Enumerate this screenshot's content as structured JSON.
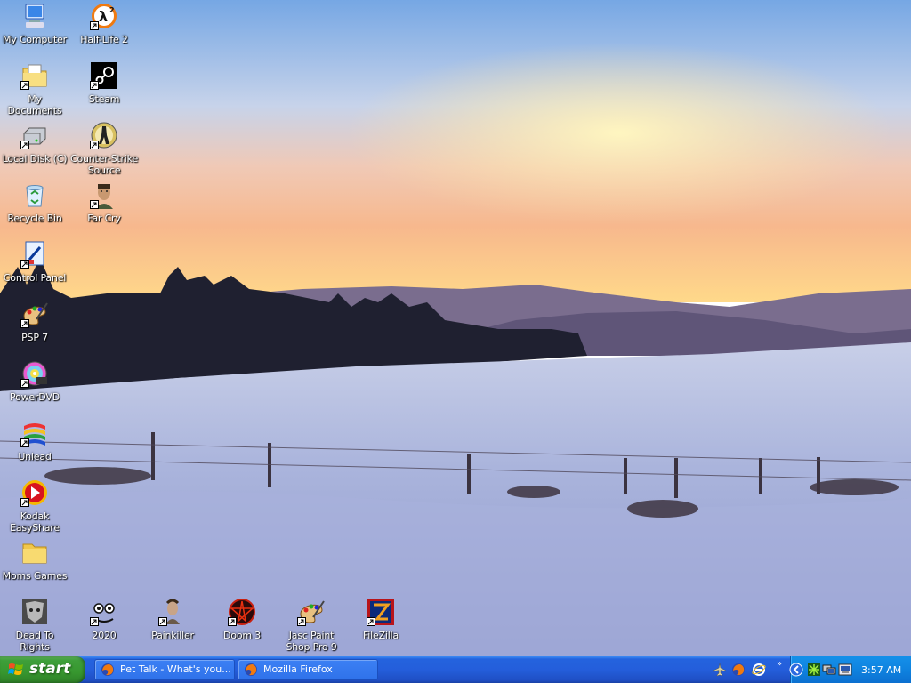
{
  "desktop_icons": [
    {
      "label": "My Computer",
      "icon": "my-computer-icon",
      "shortcut": false
    },
    {
      "label": "My Documents",
      "icon": "my-documents-icon",
      "shortcut": true
    },
    {
      "label": "Local Disk (C)",
      "icon": "local-disk-icon",
      "shortcut": true
    },
    {
      "label": "Recycle Bin",
      "icon": "recycle-bin-icon",
      "shortcut": false
    },
    {
      "label": "Control Panel",
      "icon": "control-panel-icon",
      "shortcut": true
    },
    {
      "label": "PSP 7",
      "icon": "paint-palette-icon",
      "shortcut": true
    },
    {
      "label": "PowerDVD",
      "icon": "dvd-disc-icon",
      "shortcut": true
    },
    {
      "label": "Unlead",
      "icon": "ulead-icon",
      "shortcut": true
    },
    {
      "label": "Kodak EasyShare",
      "icon": "kodak-easyshare-icon",
      "shortcut": true
    },
    {
      "label": "Moms Games",
      "icon": "folder-icon",
      "shortcut": false
    },
    {
      "label": "Dead To Rights",
      "icon": "dead-to-rights-icon",
      "shortcut": false
    },
    {
      "label": "Half-Life 2",
      "icon": "half-life-2-icon",
      "shortcut": true
    },
    {
      "label": "Steam",
      "icon": "steam-icon",
      "shortcut": true
    },
    {
      "label": "Counter-Strike Source",
      "icon": "counter-strike-icon",
      "shortcut": true
    },
    {
      "label": "Far Cry",
      "icon": "far-cry-icon",
      "shortcut": true
    },
    {
      "label": "2020",
      "icon": "2020-app-icon",
      "shortcut": true
    },
    {
      "label": "Painkiller",
      "icon": "painkiller-icon",
      "shortcut": true
    },
    {
      "label": "Doom 3",
      "icon": "doom-3-icon",
      "shortcut": true
    },
    {
      "label": "Jasc Paint Shop Pro 9",
      "icon": "paint-palette-icon",
      "shortcut": true
    },
    {
      "label": "FileZilla",
      "icon": "filezilla-icon",
      "shortcut": true
    }
  ],
  "taskbar": {
    "start_label": "start",
    "tasks": [
      {
        "label": "Pet Talk - What's you...",
        "icon": "firefox-icon"
      },
      {
        "label": "Mozilla Firefox",
        "icon": "firefox-icon"
      }
    ],
    "quick_launch": [
      "airplane-icon",
      "firefox-icon",
      "ie-icon"
    ],
    "tray_icons": [
      "tray-expand-icon",
      "network-icon",
      "display-icon",
      "safely-remove-icon"
    ],
    "clock": "3:57 AM"
  },
  "colors": {
    "taskbar": "#245edb",
    "start_button": "#37972f",
    "tray": "#0f83e0",
    "sky_top": "#7fb0e8",
    "sunset": "#ffd27a"
  }
}
